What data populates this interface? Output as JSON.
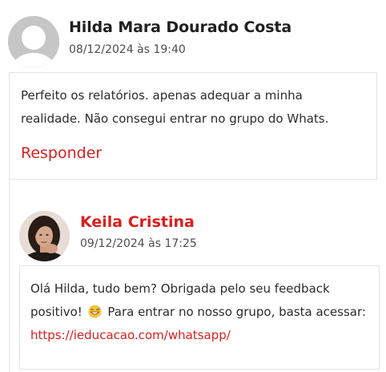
{
  "comments": [
    {
      "author": "Hilda Mara Dourado Costa",
      "date": "08/12/2024 às 19:40",
      "avatar": "default-user-avatar-icon",
      "text": "Perfeito os relatórios. apenas adequar a minha realidade. Não consegui entrar no grupo do Whats.",
      "reply_label": "Responder"
    },
    {
      "author": "Keila Cristina",
      "date": "09/12/2024 às 17:25",
      "avatar": "user-photo-avatar",
      "text_part1": "Olá Hilda, tudo bem? Obrigada pelo seu feedback positivo!",
      "emoji": "grinning-sweat-face-icon",
      "text_part2": "Para entrar no nosso grupo, basta acessar:",
      "link": "https://ieducacao.com/whatsapp/"
    }
  ],
  "colors": {
    "accent": "#d8201f",
    "text": "#2b2b2b",
    "muted": "#4d4d4d",
    "border": "#e3e3e3",
    "avatar_placeholder": "#c6c6c6"
  }
}
